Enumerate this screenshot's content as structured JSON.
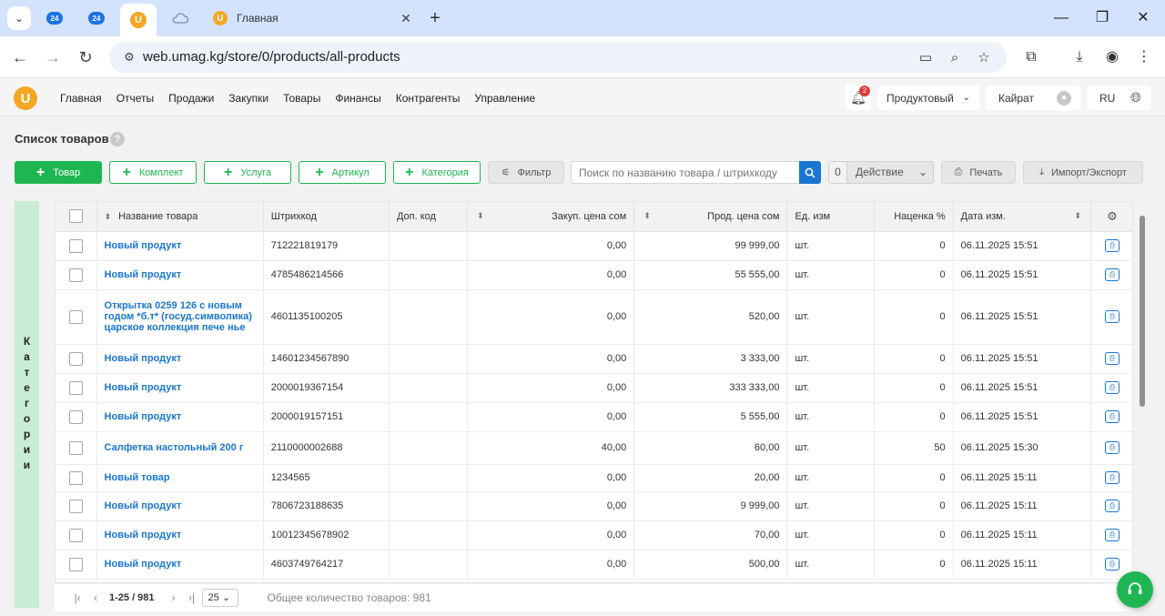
{
  "browser": {
    "tab_title": "Главная",
    "pinned_badges": [
      "24",
      "24",
      "U"
    ],
    "url": "web.umag.kg/store/0/products/all-products"
  },
  "app": {
    "logo_letter": "U",
    "menu": [
      "Главная",
      "Отчеты",
      "Продажи",
      "Закупки",
      "Товары",
      "Финансы",
      "Контрагенты",
      "Управление"
    ],
    "notifications_count": "2",
    "store_type": "Продуктовый",
    "user_name": "Кайрат",
    "language": "RU"
  },
  "page": {
    "title": "Список товаров",
    "help": "?",
    "buttons": {
      "product": "Товар",
      "kit": "Комплект",
      "service": "Услуга",
      "article": "Артикул",
      "category": "Категория",
      "filter": "Фильтр",
      "action_count": "0",
      "action": "Действие",
      "print": "Печать",
      "import_export": "Импорт/Экспорт"
    },
    "search_placeholder": "Поиск по названию товара / штрихкоду",
    "categories_tab": "Категории"
  },
  "table": {
    "headers": {
      "name": "Название товара",
      "barcode": "Штрихкод",
      "extra_code": "Доп. код",
      "purchase_price": "Закуп. цена сом",
      "sale_price": "Прод. цена сом",
      "unit": "Ед. изм",
      "markup": "Наценка %",
      "date": "Дата изм."
    },
    "rows": [
      {
        "name": "Новый продукт",
        "barcode": "712221819179",
        "extra": "",
        "purchase": "0,00",
        "sale": "99 999,00",
        "unit": "шт.",
        "markup": "0",
        "date": "06.11.2025 15:51"
      },
      {
        "name": "Новый продукт",
        "barcode": "4785486214566",
        "extra": "",
        "purchase": "0,00",
        "sale": "55 555,00",
        "unit": "шт.",
        "markup": "0",
        "date": "06.11.2025 15:51"
      },
      {
        "name": "Открытка 0259 126 с новым годом *б.т* (госуд.символика) царское коллекция пече нье",
        "barcode": "4601135100205",
        "extra": "",
        "purchase": "0,00",
        "sale": "520,00",
        "unit": "шт.",
        "markup": "0",
        "date": "06.11.2025 15:51"
      },
      {
        "name": "Новый продукт",
        "barcode": "14601234567890",
        "extra": "",
        "purchase": "0,00",
        "sale": "3 333,00",
        "unit": "шт.",
        "markup": "0",
        "date": "06.11.2025 15:51"
      },
      {
        "name": "Новый продукт",
        "barcode": "2000019367154",
        "extra": "",
        "purchase": "0,00",
        "sale": "333 333,00",
        "unit": "шт.",
        "markup": "0",
        "date": "06.11.2025 15:51"
      },
      {
        "name": "Новый продукт",
        "barcode": "2000019157151",
        "extra": "",
        "purchase": "0,00",
        "sale": "5 555,00",
        "unit": "шт.",
        "markup": "0",
        "date": "06.11.2025 15:51"
      },
      {
        "name": "Салфетка настольный 200 г",
        "barcode": "2110000002688",
        "extra": "",
        "purchase": "40,00",
        "sale": "60,00",
        "unit": "шт.",
        "markup": "50",
        "date": "06.11.2025 15:30"
      },
      {
        "name": "Новый товар",
        "barcode": "1234565",
        "extra": "",
        "purchase": "0,00",
        "sale": "20,00",
        "unit": "шт.",
        "markup": "0",
        "date": "06.11.2025 15:11"
      },
      {
        "name": "Новый продукт",
        "barcode": "7806723188635",
        "extra": "",
        "purchase": "0,00",
        "sale": "9 999,00",
        "unit": "шт.",
        "markup": "0",
        "date": "06.11.2025 15:11"
      },
      {
        "name": "Новый продукт",
        "barcode": "10012345678902",
        "extra": "",
        "purchase": "0,00",
        "sale": "70,00",
        "unit": "шт.",
        "markup": "0",
        "date": "06.11.2025 15:11"
      },
      {
        "name": "Новый продукт",
        "barcode": "4603749764217",
        "extra": "",
        "purchase": "0,00",
        "sale": "500,00",
        "unit": "шт.",
        "markup": "0",
        "date": "06.11.2025 15:11"
      }
    ]
  },
  "pagination": {
    "range": "1-25 / 981",
    "page_size": "25",
    "total": "Общее количество товаров: 981"
  },
  "colors": {
    "accent_green": "#1eb653",
    "link_blue": "#1976d2",
    "logo_orange": "#f5a623"
  }
}
